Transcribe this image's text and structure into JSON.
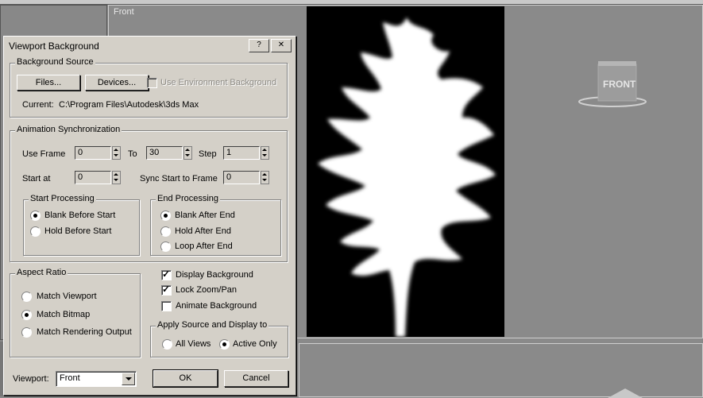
{
  "viewport": {
    "front_label": "Front",
    "viewcube_label": "FRONT"
  },
  "dialog": {
    "title": "Viewport Background",
    "help_button": "?",
    "close_button": "✕",
    "background_source": {
      "label": "Background Source",
      "files_button": "Files...",
      "devices_button": "Devices...",
      "use_env_bg_label": "Use Environment Background",
      "use_env_bg_checked": false,
      "current_label": "Current:",
      "current_value": "C:\\Program Files\\Autodesk\\3ds Max"
    },
    "animation_sync": {
      "label": "Animation Synchronization",
      "use_frame_label": "Use Frame",
      "use_frame_value": "0",
      "to_label": "To",
      "to_value": "30",
      "step_label": "Step",
      "step_value": "1",
      "start_at_label": "Start at",
      "start_at_value": "0",
      "sync_start_label": "Sync Start to Frame",
      "sync_start_value": "0",
      "start_processing": {
        "label": "Start Processing",
        "options": [
          "Blank Before Start",
          "Hold Before Start"
        ],
        "selected": "Blank Before Start"
      },
      "end_processing": {
        "label": "End Processing",
        "options": [
          "Blank After End",
          "Hold After End",
          "Loop After End"
        ],
        "selected": "Blank After End"
      }
    },
    "aspect_ratio": {
      "label": "Aspect Ratio",
      "options": [
        "Match Viewport",
        "Match Bitmap",
        "Match Rendering Output"
      ],
      "selected": "Match Bitmap"
    },
    "checkboxes": {
      "display_background": {
        "label": "Display Background",
        "checked": true
      },
      "lock_zoom_pan": {
        "label": "Lock Zoom/Pan",
        "checked": true
      },
      "animate_background": {
        "label": "Animate Background",
        "checked": false
      }
    },
    "apply_source": {
      "label": "Apply Source and Display to",
      "options": [
        "All Views",
        "Active Only"
      ],
      "selected": "Active Only"
    },
    "viewport_label": "Viewport:",
    "viewport_value": "Front",
    "ok_button": "OK",
    "cancel_button": "Cancel"
  }
}
